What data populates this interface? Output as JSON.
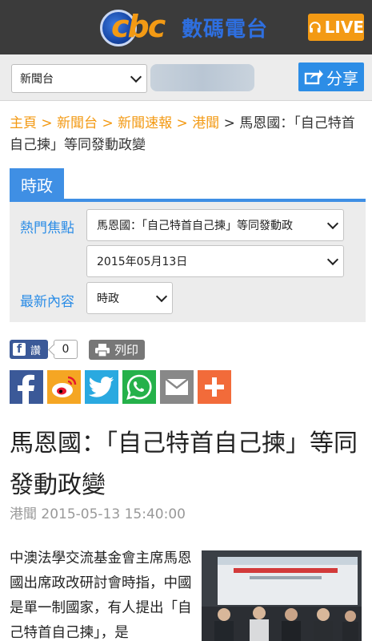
{
  "header": {
    "logo_text": "cbc",
    "logo_cn": "數碼電台",
    "live_label": "LIVE"
  },
  "toolbar": {
    "station_select": "新聞台",
    "share_label": "分享"
  },
  "breadcrumb": {
    "items": [
      "主頁",
      "新聞台",
      "新聞速報",
      "港聞"
    ],
    "separator": ">",
    "current": "馬恩國：「自己特首自己揀」等同發動政變"
  },
  "filter": {
    "tab_label": "時政",
    "hot_label": "熱門焦點",
    "hot_select": "馬恩國：「自己特首自己揀」等同發動政",
    "date_select": "2015年05月13日",
    "latest_label": "最新內容",
    "latest_select": "時政"
  },
  "social": {
    "like_label": "讚",
    "like_count": "0",
    "print_label": "列印",
    "share_icons": [
      "facebook-icon",
      "weibo-icon",
      "twitter-icon",
      "whatsapp-icon",
      "email-icon",
      "plus-icon"
    ],
    "colors": {
      "facebook": "#3b5998",
      "weibo": "#f5a623",
      "twitter": "#2aa9e0",
      "whatsapp": "#25b14a",
      "email": "#888888",
      "plus": "#f26b3a"
    }
  },
  "article": {
    "title": "馬恩國：「自己特首自己揀」等同發動政變",
    "category": "港聞",
    "datetime": "2015-05-13 15:40:00",
    "body": "中澳法學交流基金會主席馬恩國出席政改研討會時指，中國是單一制國家，有人提出「自己特首自己揀」，是"
  },
  "colors": {
    "accent_orange": "#f39a14",
    "accent_blue": "#3f8fe4",
    "header_bg": "#3b3b3b"
  }
}
